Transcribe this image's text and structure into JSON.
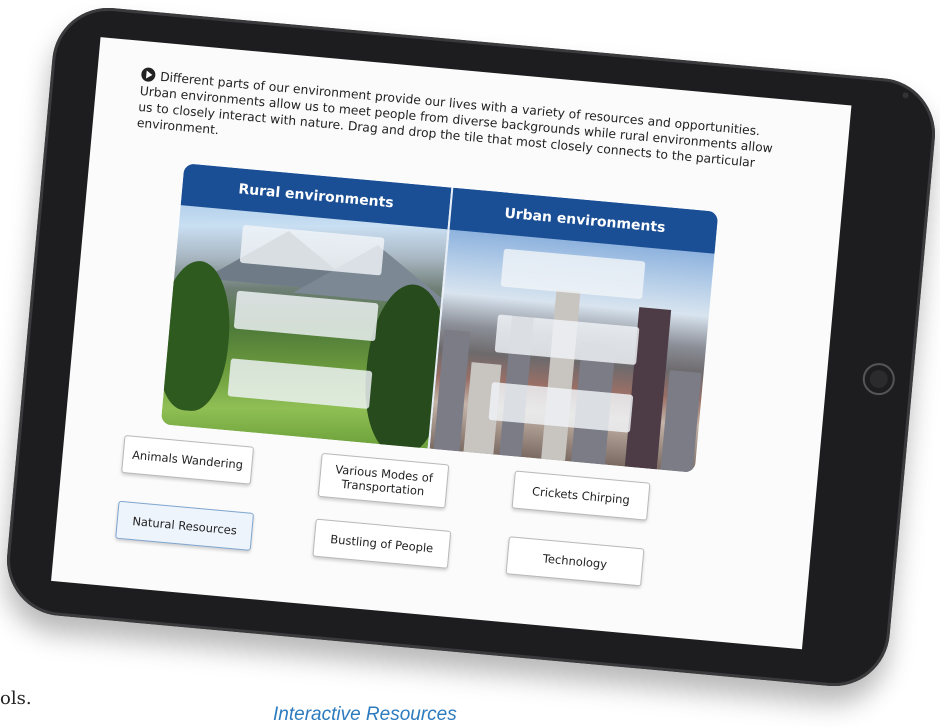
{
  "page": {
    "stub_text": "ols.",
    "caption": "Interactive Resources"
  },
  "activity": {
    "instructions": "Different parts of our environment provide our lives with a variety of resources and opportunities. Urban environments allow us to meet people from diverse backgrounds while rural environments allow us to closely interact with nature. Drag and drop the tile that most closely connects to the particular environment.",
    "columns": [
      {
        "title": "Rural environments"
      },
      {
        "title": "Urban environments"
      }
    ],
    "tiles": [
      {
        "label": "Animals Wandering",
        "selected": false
      },
      {
        "label": "Various Modes of Transportation",
        "selected": false
      },
      {
        "label": "Crickets Chirping",
        "selected": false
      },
      {
        "label": "Natural Resources",
        "selected": true
      },
      {
        "label": "Bustling of People",
        "selected": false
      },
      {
        "label": "Technology",
        "selected": false
      }
    ]
  },
  "colors": {
    "header_blue": "#1b4f95",
    "caption_blue": "#2d7bbf",
    "tablet_bezel": "#1d1d1f"
  }
}
